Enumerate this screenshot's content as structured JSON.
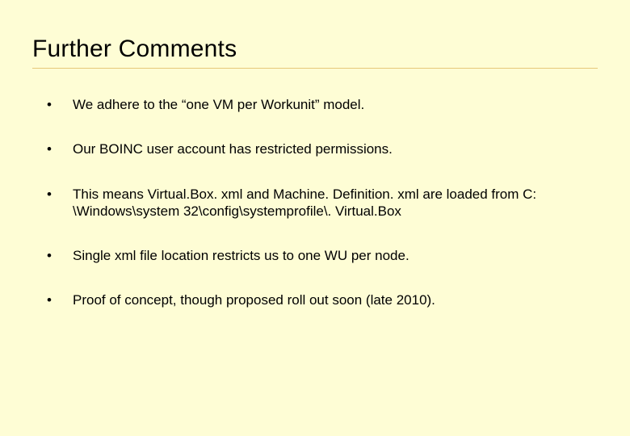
{
  "title": "Further Comments",
  "bullets": [
    "We adhere to the “one VM per Workunit” model.",
    "Our BOINC user account has restricted permissions.",
    " This means Virtual.Box. xml and Machine. Definition. xml are loaded from C: \\Windows\\system 32\\config\\systemprofile\\. Virtual.Box",
    "Single xml file location restricts us to one WU per node.",
    "Proof of concept, though proposed roll out soon (late 2010)."
  ]
}
